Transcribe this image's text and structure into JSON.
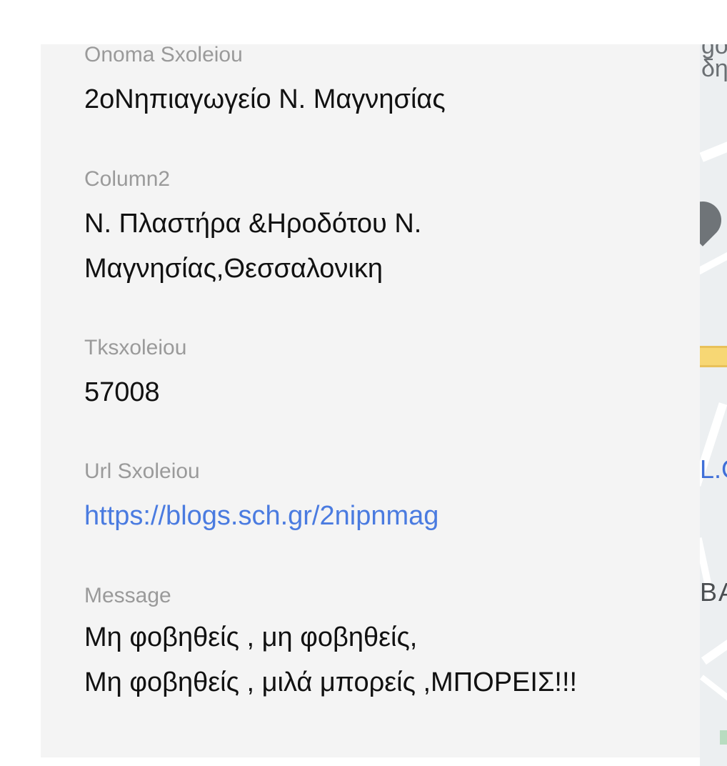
{
  "record": {
    "fields": [
      {
        "label": "Onoma Sxoleiou",
        "value": "2oΝηπιαγωγείο Ν. Μαγνησίας"
      },
      {
        "label": "Column2",
        "value": "Ν. Πλαστήρα &Ηροδότου Ν.\nΜαγνησίας,Θεσσαλονικη"
      },
      {
        "label": "Tksxoleiou",
        "value": "57008"
      },
      {
        "label": "Url Sxoleiou",
        "value": "https://blogs.sch.gr/2nipnmag"
      },
      {
        "label": "Message",
        "value": "Μη φοβηθείς , μη φοβηθείς,\nΜη φοβηθείς , μιλά μπορείς ,ΜΠΟΡΕΙΣ!!!"
      }
    ]
  },
  "map": {
    "label_top": "go\nδη",
    "label_blue": "L.C",
    "label_dark": "BA",
    "pin_icon": "map-pin-icon"
  },
  "colors": {
    "panel_background": "#f4f4f4",
    "label_text": "#9a9a9a",
    "value_text": "#111111",
    "link_text": "#4a7be0"
  }
}
